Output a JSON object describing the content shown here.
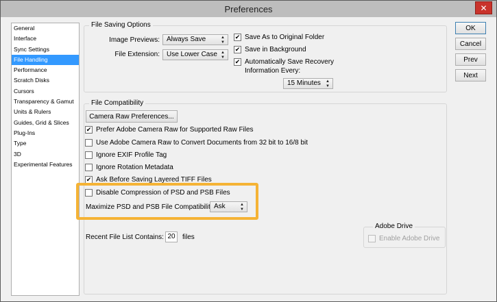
{
  "window": {
    "title": "Preferences",
    "close_glyph": "✕"
  },
  "sidebar": {
    "items": [
      {
        "label": "General",
        "selected": false
      },
      {
        "label": "Interface",
        "selected": false
      },
      {
        "label": "Sync Settings",
        "selected": false
      },
      {
        "label": "File Handling",
        "selected": true
      },
      {
        "label": "Performance",
        "selected": false
      },
      {
        "label": "Scratch Disks",
        "selected": false
      },
      {
        "label": "Cursors",
        "selected": false
      },
      {
        "label": "Transparency & Gamut",
        "selected": false
      },
      {
        "label": "Units & Rulers",
        "selected": false
      },
      {
        "label": "Guides, Grid & Slices",
        "selected": false
      },
      {
        "label": "Plug-Ins",
        "selected": false
      },
      {
        "label": "Type",
        "selected": false
      },
      {
        "label": "3D",
        "selected": false
      },
      {
        "label": "Experimental Features",
        "selected": false
      }
    ]
  },
  "file_saving": {
    "legend": "File Saving Options",
    "image_previews_label": "Image Previews:",
    "image_previews_value": "Always Save",
    "file_extension_label": "File Extension:",
    "file_extension_value": "Use Lower Case",
    "save_as_original": {
      "label": "Save As to Original Folder",
      "checked": true
    },
    "save_in_background": {
      "label": "Save in Background",
      "checked": true
    },
    "auto_save": {
      "label_line1": "Automatically Save Recovery",
      "label_line2": "Information Every:",
      "checked": true
    },
    "auto_save_interval": "15 Minutes"
  },
  "file_compat": {
    "legend": "File Compatibility",
    "camera_raw_button": "Camera Raw Preferences...",
    "prefer_acr": {
      "label": "Prefer Adobe Camera Raw for Supported Raw Files",
      "checked": true
    },
    "use_acr_convert": {
      "label": "Use Adobe Camera Raw to Convert Documents from 32 bit to 16/8 bit",
      "checked": false
    },
    "ignore_exif": {
      "label": "Ignore EXIF Profile Tag",
      "checked": false
    },
    "ignore_rotation": {
      "label": "Ignore Rotation Metadata",
      "checked": false
    },
    "ask_tiff": {
      "label": "Ask Before Saving Layered TIFF Files",
      "checked": true
    },
    "disable_compression": {
      "label": "Disable Compression of PSD and PSB Files",
      "checked": false
    },
    "maximize_label": "Maximize PSD and PSB File Compatibility:",
    "maximize_value": "Ask",
    "highlight_color": "#f5b335"
  },
  "adobe_drive": {
    "legend": "Adobe Drive",
    "enable": {
      "label": "Enable Adobe Drive",
      "checked": false
    }
  },
  "recent_files": {
    "label": "Recent File List Contains:",
    "value": "20",
    "suffix": "files"
  },
  "buttons": {
    "ok": "OK",
    "cancel": "Cancel",
    "prev": "Prev",
    "next": "Next"
  },
  "icons": {
    "check": "✔",
    "dropdown_up": "▲",
    "dropdown_down": "▼"
  }
}
